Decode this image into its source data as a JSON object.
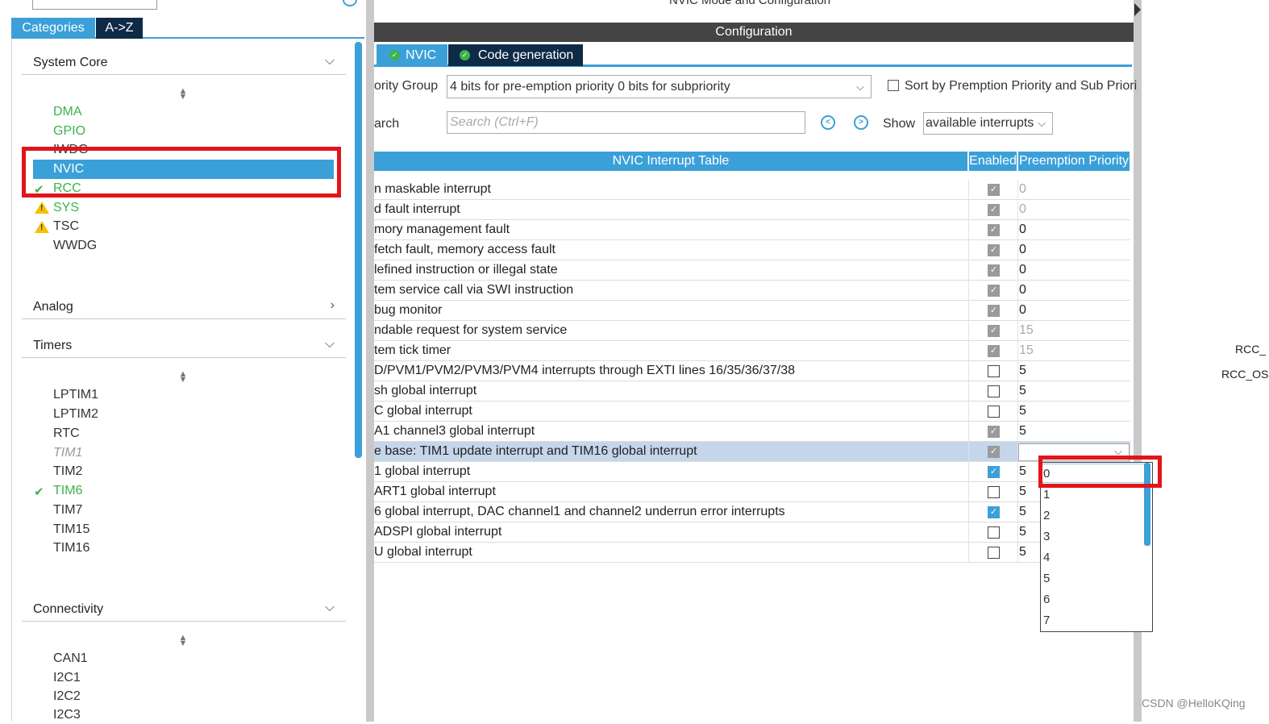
{
  "left": {
    "tabs": {
      "categories": "Categories",
      "az": "A->Z"
    },
    "sections": {
      "system_core": "System Core",
      "analog": "Analog",
      "timers": "Timers",
      "connectivity": "Connectivity"
    },
    "system_core_items": [
      "DMA",
      "GPIO",
      "IWDG",
      "NVIC",
      "RCC",
      "SYS",
      "TSC",
      "WWDG"
    ],
    "timer_items": [
      "LPTIM1",
      "LPTIM2",
      "RTC",
      "TIM1",
      "TIM2",
      "TIM6",
      "TIM7",
      "TIM15",
      "TIM16"
    ],
    "connectivity_items": [
      "CAN1",
      "I2C1",
      "I2C2",
      "I2C3"
    ]
  },
  "main": {
    "mode_title": "NVIC Mode and Configuration",
    "config_title": "Configuration",
    "tabs": {
      "nvic": "NVIC",
      "code": "Code generation"
    },
    "priority_group_label": "ority Group",
    "priority_group_value": "4 bits for pre-emption priority 0 bits for subpriority",
    "sort_label": "Sort by Premption Priority and Sub Priori",
    "search_label": "arch",
    "search_placeholder": "Search (Ctrl+F)",
    "show_label": "Show",
    "show_value": "available interrupts",
    "table_headers": {
      "name": "NVIC Interrupt Table",
      "enabled": "Enabled",
      "preemption": "Preemption Priority"
    },
    "rows": [
      {
        "name": "n maskable interrupt",
        "prio": "0"
      },
      {
        "name": "d fault interrupt",
        "prio": "0"
      },
      {
        "name": "mory management fault",
        "prio": "0"
      },
      {
        "name": "fetch fault, memory access fault",
        "prio": "0"
      },
      {
        "name": "lefined instruction or illegal state",
        "prio": "0"
      },
      {
        "name": "tem service call via SWI instruction",
        "prio": "0"
      },
      {
        "name": "bug monitor",
        "prio": "0"
      },
      {
        "name": "ndable request for system service",
        "prio": "15"
      },
      {
        "name": "tem tick timer",
        "prio": "15"
      },
      {
        "name": "D/PVM1/PVM2/PVM3/PVM4 interrupts through EXTI lines 16/35/36/37/38",
        "prio": "5"
      },
      {
        "name": "sh global interrupt",
        "prio": "5"
      },
      {
        "name": "C global interrupt",
        "prio": "5"
      },
      {
        "name": "A1 channel3 global interrupt",
        "prio": "5"
      },
      {
        "name": "e base: TIM1 update interrupt and TIM16 global interrupt",
        "prio": ""
      },
      {
        "name": "1 global interrupt",
        "prio": "5"
      },
      {
        "name": "ART1 global interrupt",
        "prio": "5"
      },
      {
        "name": "6 global interrupt, DAC channel1 and channel2 underrun error interrupts",
        "prio": "5"
      },
      {
        "name": "ADSPI global interrupt",
        "prio": "5"
      },
      {
        "name": "U global interrupt",
        "prio": "5"
      }
    ],
    "dropdown_options": [
      "0",
      "1",
      "2",
      "3",
      "4",
      "5",
      "6",
      "7"
    ]
  },
  "side_labels": {
    "rcc1": "RCC_",
    "rcc2": "RCC_OS"
  },
  "watermark": "CSDN @HelloKQing"
}
